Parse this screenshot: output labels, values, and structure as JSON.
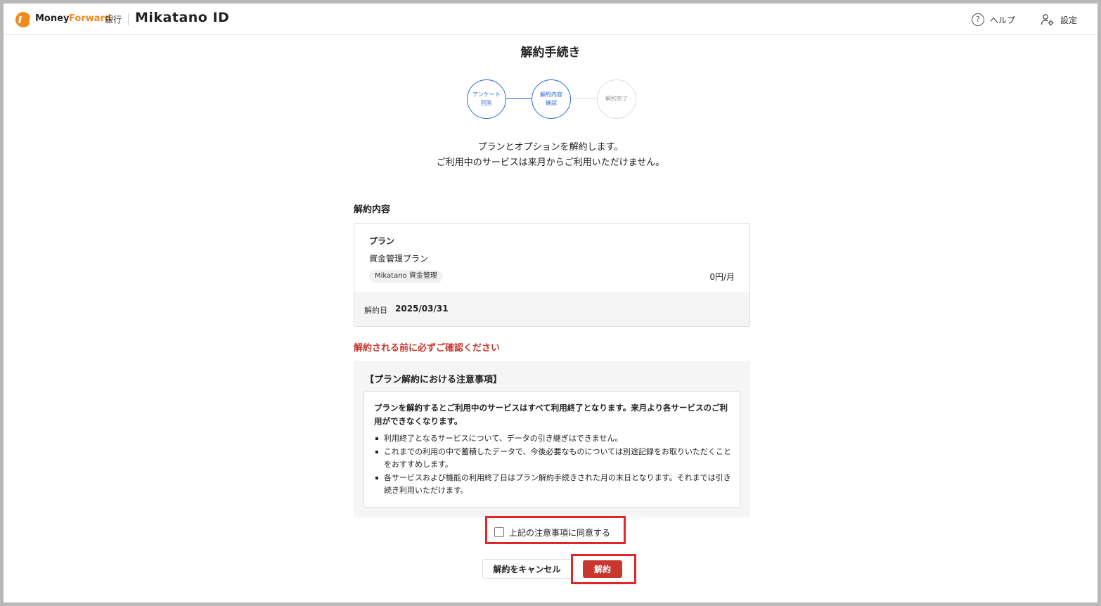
{
  "header": {
    "brand_money": "Money",
    "brand_forward": "Forward",
    "brand_bank": "銀行",
    "brand_mikatano": "Mikatano ID",
    "help_label": "ヘルプ",
    "settings_label": "設定",
    "accent_color": "#f08a1f"
  },
  "page": {
    "title": "解約手続き"
  },
  "stepper": {
    "steps": [
      {
        "line1": "アンケート",
        "line2": "回答",
        "state": "done"
      },
      {
        "line1": "解約内容",
        "line2": "確認",
        "state": "current"
      },
      {
        "line1": "解約完了",
        "line2": "",
        "state": "pending"
      }
    ],
    "active_color": "#2f6ad0"
  },
  "intro": {
    "line1": "プランとオプションを解約します。",
    "line2": "ご利用中のサービスは来月からご利用いただけません。"
  },
  "details": {
    "section_title": "解約内容",
    "plan_heading": "プラン",
    "plan_name": "資金管理プラン",
    "service_tag": "Mikatano 資金管理",
    "price": "0円/月",
    "date_label": "解約日",
    "date_value": "2025/03/31"
  },
  "notice": {
    "warning_title": "解約される前に必ずご確認ください",
    "heading": "【プラン解約における注意事項】",
    "lead": "プランを解約するとご利用中のサービスはすべて利用終了となります。来月より各サービスのご利用ができなくなります。",
    "items": [
      "利用終了となるサービスについて、データの引き継ぎはできません。",
      "これまでの利用の中で蓄積したデータで、今後必要なものについては別途記録をお取りいただくことをおすすめします。",
      "各サービスおよび機能の利用終了日はプラン解約手続きされた月の末日となります。それまでは引き続き利用いただけます。"
    ],
    "warning_color": "#c8372d"
  },
  "agreement": {
    "label": "上記の注意事項に同意する",
    "checked": false,
    "highlight_color": "#e02626"
  },
  "actions": {
    "cancel_label": "解約をキャンセル",
    "submit_label": "解約",
    "submit_color": "#c8372d"
  }
}
